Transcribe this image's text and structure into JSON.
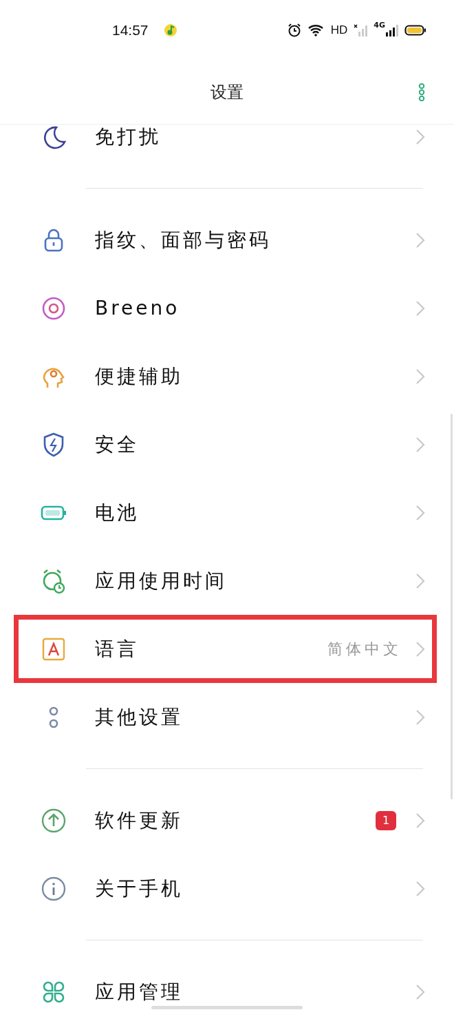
{
  "status_bar": {
    "time": "14:57",
    "hd": "HD",
    "network": "4G"
  },
  "header": {
    "title": "设置"
  },
  "groups": [
    {
      "items": [
        {
          "label": "免打扰",
          "highlighted": false
        }
      ]
    },
    {
      "items": [
        {
          "label": "指纹、面部与密码",
          "highlighted": false
        },
        {
          "label": "Breeno",
          "highlighted": false
        },
        {
          "label": "便捷辅助",
          "highlighted": false
        },
        {
          "label": "安全",
          "highlighted": false
        },
        {
          "label": "电池",
          "highlighted": false
        },
        {
          "label": "应用使用时间",
          "highlighted": false
        },
        {
          "label": "语言",
          "value": "简体中文",
          "highlighted": true
        },
        {
          "label": "其他设置",
          "highlighted": false
        }
      ]
    },
    {
      "items": [
        {
          "label": "软件更新",
          "badge": "1",
          "highlighted": false
        },
        {
          "label": "关于手机",
          "highlighted": false
        }
      ]
    },
    {
      "items": [
        {
          "label": "应用管理",
          "highlighted": false
        }
      ]
    }
  ]
}
